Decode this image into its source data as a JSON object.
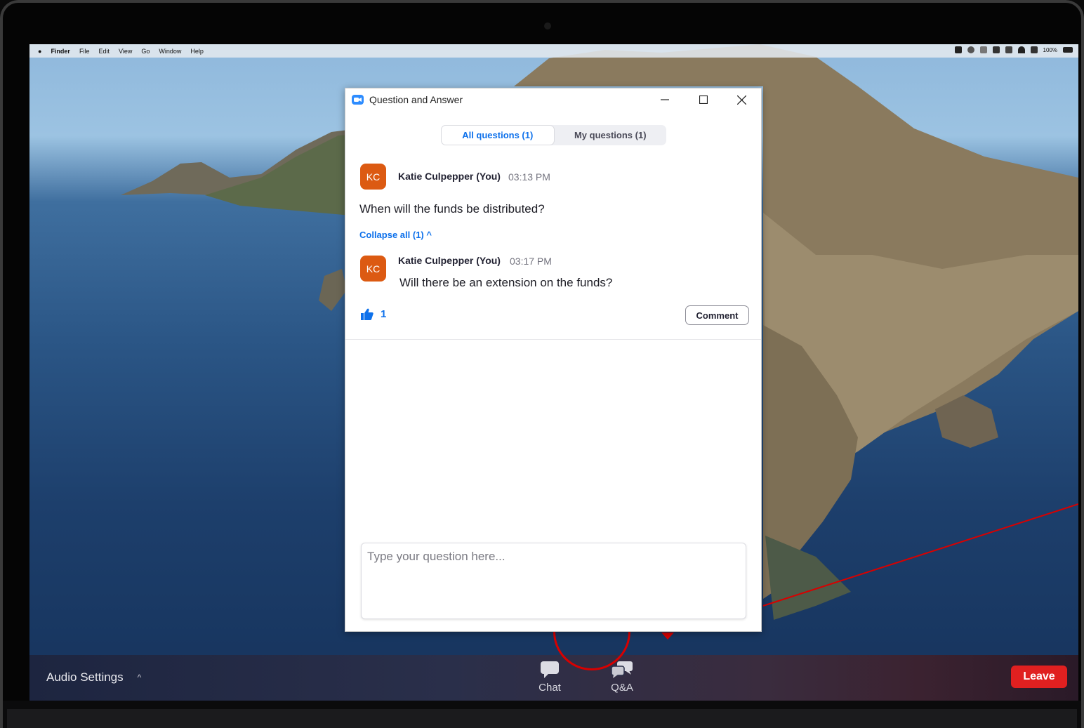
{
  "menubar": {
    "apple": "",
    "items": [
      "Finder",
      "File",
      "Edit",
      "View",
      "Go",
      "Window",
      "Help"
    ],
    "battery": "100%"
  },
  "dialog": {
    "title": "Question and Answer",
    "tabs": [
      {
        "label": "All questions (1)",
        "active": true
      },
      {
        "label": "My questions (1)",
        "active": false
      }
    ],
    "question": {
      "avatar": "KC",
      "author": "Katie Culpepper (You)",
      "time": "03:13 PM",
      "text": "When will the funds be distributed?"
    },
    "collapse_label": "Collapse all (1) ^",
    "reply": {
      "avatar": "KC",
      "author": "Katie Culpepper (You)",
      "time": "03:17 PM",
      "text": "Will there be an extension on the funds?"
    },
    "like_count": "1",
    "comment_label": "Comment",
    "input_placeholder": "Type your question here..."
  },
  "bottombar": {
    "audio_settings": "Audio Settings",
    "chat_label": "Chat",
    "qa_label": "Q&A",
    "leave_label": "Leave"
  },
  "colors": {
    "accent": "#0e71eb",
    "avatar": "#dc5a12",
    "leave": "#e02020",
    "annotation": "#d80000"
  }
}
